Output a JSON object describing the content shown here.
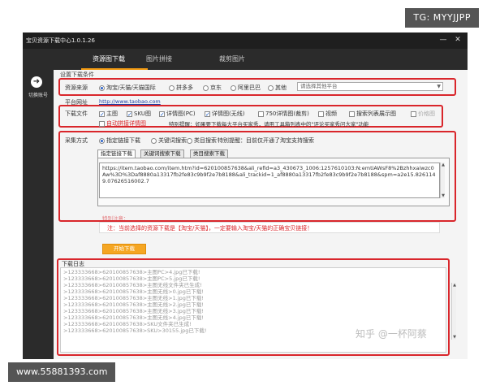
{
  "window": {
    "title": "宝贝资源下载中心1.0.1.26",
    "minimize_glyph": "—",
    "close_glyph": "✕"
  },
  "tabs": [
    {
      "label": "资源图下载",
      "active": true
    },
    {
      "label": "图片拼接",
      "active": false
    },
    {
      "label": "裁剪图片",
      "active": false
    }
  ],
  "sidebar": {
    "icon": "arrow-right-icon",
    "switch_label": "切换账号"
  },
  "settings": {
    "section_title": "设置下载条件",
    "source": {
      "label": "资源来源",
      "options": [
        "淘宝/天猫/天猫国际",
        "拼多多",
        "京东",
        "阿里巴巴",
        "其他"
      ],
      "selected": "淘宝/天猫/天猫国际",
      "platform_placeholder": "请选择其他平台"
    },
    "platform_url": {
      "label": "平台网址",
      "value": "http://www.taobao.com"
    },
    "files": {
      "label": "下载文件",
      "options": [
        {
          "label": "主图",
          "checked": true
        },
        {
          "label": "SKU图",
          "checked": true
        },
        {
          "label": "详情图(PC)",
          "checked": true
        },
        {
          "label": "详情图(无线)",
          "checked": true
        },
        {
          "label": "750详情图(裁剪)",
          "checked": false
        },
        {
          "label": "视频",
          "checked": false
        },
        {
          "label": "搜索列表展示图",
          "checked": false
        },
        {
          "label": "价格图",
          "checked": false
        }
      ],
      "auto_concat_label": "自动拼接详情图",
      "note": "特别提醒：如果要下载每大平台买家秀，请用工具箱列表中的\"评论买家秀问大家\"功能"
    }
  },
  "collect": {
    "label": "采集方式",
    "options": [
      "指定链接下载",
      "关键词搜索",
      "类目搜索"
    ],
    "selected": "指定链接下载",
    "note": "特别提醒：目前仅开通了淘宝支持搜索",
    "subtabs": [
      "指定链接下载",
      "关键词搜索下载",
      "类目搜索下载"
    ],
    "link_text": "https://item.taobao.com/item.htm?id=620100857638&ali_refid=a3_430673_1006:1257610103:N:emtiAWsF8%2Bzhhxaiwzc0Aw%3D%3Daf8880a13317fb2fe83c9b9f2e7b8188&ali_trackid=1_af8880a13317fb2fe83c9b9f2e7b8188&spm=a2e15.8261149.07626516002.7",
    "warning_title": "特别注意：",
    "warning_text": "注：当前选择的资源下载是【淘宝/天猫】，一定要输入淘宝/天猫的正确宝贝链接！"
  },
  "start_button": "开始下载",
  "log": {
    "title": "下载日志",
    "lines": [
      ">123333668>620100857638>主图PC>4.jpg已下载!",
      ">123333668>620100857638>主图PC>5.jpg已下载!",
      ">123333668>620100857638>主图无线文件夹已生成!",
      ">123333668>620100857638>主图无线>0.jpg已下载!",
      ">123333668>620100857638>主图无线>1.jpg已下载!",
      ">123333668>620100857638>主图无线>2.jpg已下载!",
      ">123333668>620100857638>主图无线>3.jpg已下载!",
      ">123333668>620100857638>主图无线>4.jpg已下载!",
      ">123333668>620100857638>SKU文件夹已生成!",
      ">123333668>620100857638>SKU>30155.jpg已下载!"
    ]
  },
  "watermarks": {
    "top_right": "TG: MYYJJPP",
    "bottom_left": "www.55881393.com",
    "zhihu": "知乎 @一杯阿蔡"
  },
  "colors": {
    "accent": "#f39c12",
    "highlight_box": "#d9262b",
    "chrome": "#2b2b2b"
  }
}
